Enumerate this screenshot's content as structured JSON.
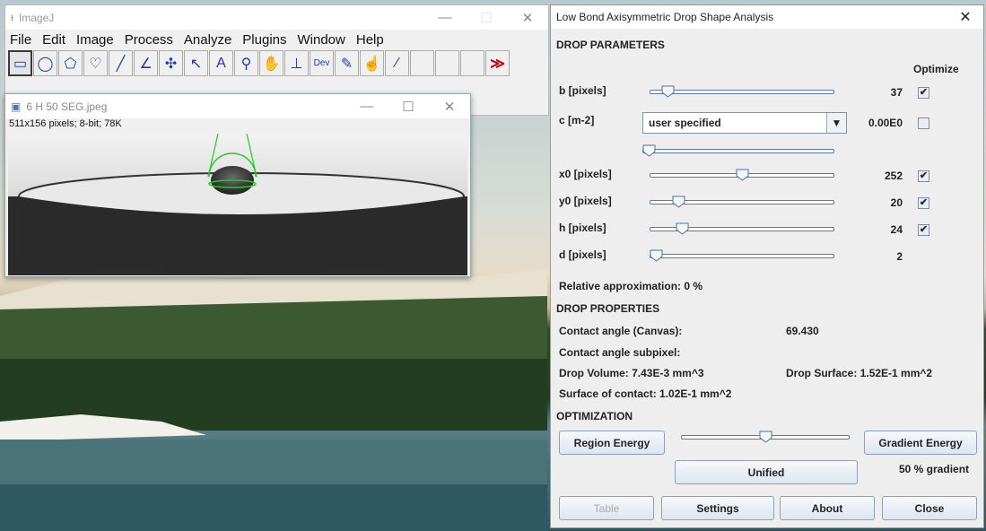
{
  "imagej": {
    "title": "ImageJ",
    "menu": [
      "File",
      "Edit",
      "Image",
      "Process",
      "Analyze",
      "Plugins",
      "Window",
      "Help"
    ],
    "tools": [
      {
        "name": "rectangle-tool-icon",
        "glyph": "▭"
      },
      {
        "name": "oval-tool-icon",
        "glyph": "◯"
      },
      {
        "name": "polygon-tool-icon",
        "glyph": "⬠"
      },
      {
        "name": "freehand-tool-icon",
        "glyph": "♡"
      },
      {
        "name": "line-tool-icon",
        "glyph": "╱"
      },
      {
        "name": "angle-tool-icon",
        "glyph": "∠"
      },
      {
        "name": "point-tool-icon",
        "glyph": "✣"
      },
      {
        "name": "wand-tool-icon",
        "glyph": "↖"
      },
      {
        "name": "text-tool-icon",
        "glyph": "A"
      },
      {
        "name": "magnifier-tool-icon",
        "glyph": "⚲"
      },
      {
        "name": "hand-tool-icon",
        "glyph": "✋"
      },
      {
        "name": "color-picker-icon",
        "glyph": "⊥"
      },
      {
        "name": "dev-menu-icon",
        "glyph": "Dev"
      },
      {
        "name": "brush-tool-icon",
        "glyph": "✎"
      },
      {
        "name": "drop-tool-icon",
        "glyph": "☝"
      },
      {
        "name": "pipette-tool-icon",
        "glyph": "⁄"
      },
      {
        "name": "empty-slot-icon",
        "glyph": ""
      },
      {
        "name": "empty-slot-icon",
        "glyph": ""
      },
      {
        "name": "empty-slot-icon",
        "glyph": ""
      },
      {
        "name": "more-tools-icon",
        "glyph": "≫"
      }
    ]
  },
  "image_window": {
    "title": "6 H 50 SEG.jpeg",
    "info": "511x156 pixels; 8-bit; 78K"
  },
  "dsa": {
    "title": "Low Bond Axisymmetric Drop Shape Analysis",
    "section_params": "DROP PARAMETERS",
    "optimize_header": "Optimize",
    "params": [
      {
        "label": "b [pixels]",
        "value": "37",
        "level": 0.07,
        "checked": true
      },
      {
        "label": "x0 [pixels]",
        "value": "252",
        "level": 0.5,
        "checked": true
      },
      {
        "label": "y0 [pixels]",
        "value": "20",
        "level": 0.13,
        "checked": true
      },
      {
        "label": "h [pixels]",
        "value": "24",
        "level": 0.15,
        "checked": true
      },
      {
        "label": "d [pixels]",
        "value": "2",
        "level": 0.0,
        "checked": null
      }
    ],
    "c_label": "c [m-2]",
    "c_combo": "user specified",
    "c_value": "0.00E0",
    "c_checked": false,
    "c_level": 0.0,
    "relative_approx": "Relative approximation: 0 %",
    "section_props": "DROP PROPERTIES",
    "contact_angle_label": "Contact angle (Canvas):",
    "contact_angle_value": "69.430",
    "contact_angle_subpixel": "Contact angle subpixel:",
    "drop_volume": "Drop Volume: 7.43E-3 mm^3",
    "drop_surface": "Drop Surface: 1.52E-1 mm^2",
    "surface_contact": "Surface of contact: 1.02E-1 mm^2",
    "section_opt": "OPTIMIZATION",
    "region_energy": "Region Energy",
    "gradient_energy": "Gradient Energy",
    "opt_level": 0.5,
    "unified": "Unified",
    "gradient_pct": "50 % gradient",
    "btn_table": "Table",
    "btn_settings": "Settings",
    "btn_about": "About",
    "btn_close": "Close"
  }
}
